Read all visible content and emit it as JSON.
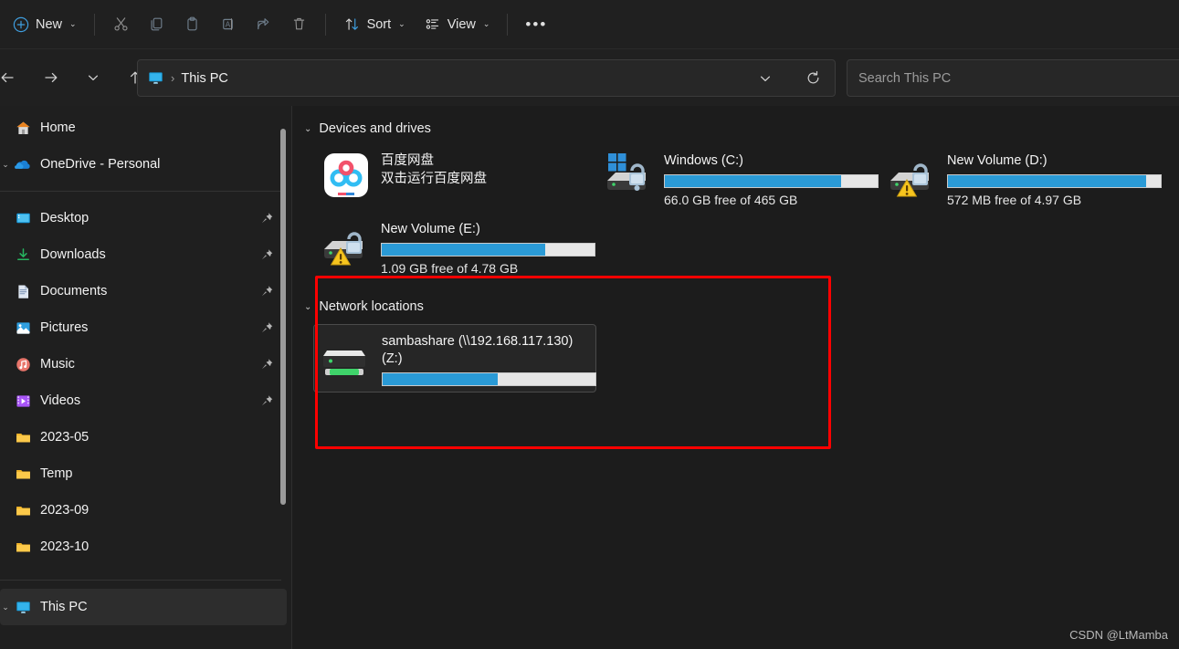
{
  "toolbar": {
    "new_label": "New",
    "sort_label": "Sort",
    "view_label": "View",
    "overflow_label": "…",
    "items": [
      {
        "name": "new-button",
        "label": "New",
        "icon": "plus-circle-icon"
      },
      {
        "name": "cut-button",
        "label": "Cut",
        "icon": "scissors-icon"
      },
      {
        "name": "copy-button",
        "label": "Copy",
        "icon": "copy-icon"
      },
      {
        "name": "paste-button",
        "label": "Paste",
        "icon": "clipboard-icon"
      },
      {
        "name": "rename-button",
        "label": "Rename",
        "icon": "rename-icon"
      },
      {
        "name": "share-button",
        "label": "Share",
        "icon": "share-icon"
      },
      {
        "name": "delete-button",
        "label": "Delete",
        "icon": "trash-icon"
      },
      {
        "name": "sort-button",
        "label": "Sort",
        "icon": "sort-arrows-icon"
      },
      {
        "name": "view-button",
        "label": "View",
        "icon": "view-list-icon"
      },
      {
        "name": "see-more-button",
        "label": "…",
        "icon": "ellipsis-icon"
      }
    ]
  },
  "navigation": {
    "back_label": "Back",
    "forward_label": "Forward",
    "recent_label": "Recent locations",
    "up_label": "Up",
    "refresh_label": "Refresh",
    "address_dropdown_label": "Previous locations"
  },
  "address": {
    "icon": "this-pc-icon",
    "separator": "›",
    "crumb": "This PC"
  },
  "search": {
    "placeholder": "Search This PC"
  },
  "sidebar": {
    "top_items": [
      {
        "label": "Home",
        "icon": "home-icon",
        "pinned": false,
        "selected": false,
        "expander": false
      },
      {
        "label": "OneDrive - Personal",
        "icon": "onedrive-cloud-icon",
        "pinned": false,
        "selected": false,
        "expander": true
      }
    ],
    "quick_items": [
      {
        "label": "Desktop",
        "icon": "desktop-icon",
        "pinned": true,
        "selected": false
      },
      {
        "label": "Downloads",
        "icon": "downloads-icon",
        "pinned": true,
        "selected": false
      },
      {
        "label": "Documents",
        "icon": "documents-icon",
        "pinned": true,
        "selected": false
      },
      {
        "label": "Pictures",
        "icon": "pictures-icon",
        "pinned": true,
        "selected": false
      },
      {
        "label": "Music",
        "icon": "music-icon",
        "pinned": true,
        "selected": false
      },
      {
        "label": "Videos",
        "icon": "videos-icon",
        "pinned": true,
        "selected": false
      },
      {
        "label": "2023-05",
        "icon": "folder-icon",
        "pinned": false,
        "selected": false
      },
      {
        "label": "Temp",
        "icon": "folder-icon",
        "pinned": false,
        "selected": false
      },
      {
        "label": "2023-09",
        "icon": "folder-icon",
        "pinned": false,
        "selected": false
      },
      {
        "label": "2023-10",
        "icon": "folder-icon",
        "pinned": false,
        "selected": false
      }
    ],
    "bottom_items": [
      {
        "label": "This PC",
        "icon": "this-pc-icon",
        "pinned": false,
        "selected": true,
        "expander": true
      }
    ]
  },
  "main": {
    "groups": [
      {
        "name": "devices-and-drives",
        "title": "Devices and drives",
        "expanded": true,
        "tiles": [
          {
            "name": "baidu-netdisk",
            "icon": "baidu-netdisk-icon",
            "title": "百度网盘",
            "subtitle": "双击运行百度网盘",
            "has_bar": false,
            "selected": false,
            "warning": false
          },
          {
            "name": "windows-c-drive",
            "icon": "drive-bitlocker-unlocked-icon",
            "title": "Windows (C:)",
            "subtitle": "66.0 GB free of 465 GB",
            "has_bar": true,
            "used_percent": 83,
            "selected": false,
            "warning": false,
            "free_space": "66.0 GB",
            "total_space": "465 GB"
          },
          {
            "name": "new-volume-d-drive",
            "icon": "drive-bitlocker-unlocked-icon",
            "title": "New Volume (D:)",
            "subtitle": "572 MB free of 4.97 GB",
            "has_bar": true,
            "used_percent": 93,
            "selected": false,
            "warning": true,
            "free_space": "572 MB",
            "total_space": "4.97 GB"
          },
          {
            "name": "new-volume-e-drive",
            "icon": "drive-bitlocker-unlocked-icon",
            "title": "New Volume (E:)",
            "subtitle": "1.09 GB free of 4.78 GB",
            "has_bar": true,
            "used_percent": 77,
            "selected": false,
            "warning": true,
            "free_space": "1.09 GB",
            "total_space": "4.78 GB"
          }
        ]
      },
      {
        "name": "network-locations",
        "title": "Network locations",
        "expanded": true,
        "tiles": [
          {
            "name": "sambashare-z-drive",
            "icon": "network-drive-icon",
            "title": "sambashare (\\\\192.168.117.130) (Z:)",
            "subtitle": "",
            "has_bar": true,
            "used_percent": 54,
            "selected": true,
            "warning": false
          }
        ]
      }
    ]
  },
  "annotation": {
    "highlight_color": "#fe0000",
    "highlight_target": "network-locations"
  },
  "watermark": {
    "text": "CSDN @LtMamba"
  },
  "colors": {
    "accent_blue": "#2a9ad6",
    "window_bg": "#1c1c1c",
    "sidebar_bg": "#1f1f1f",
    "toolbar_bg": "#202020",
    "selection_bg": "#2d2d2d"
  }
}
